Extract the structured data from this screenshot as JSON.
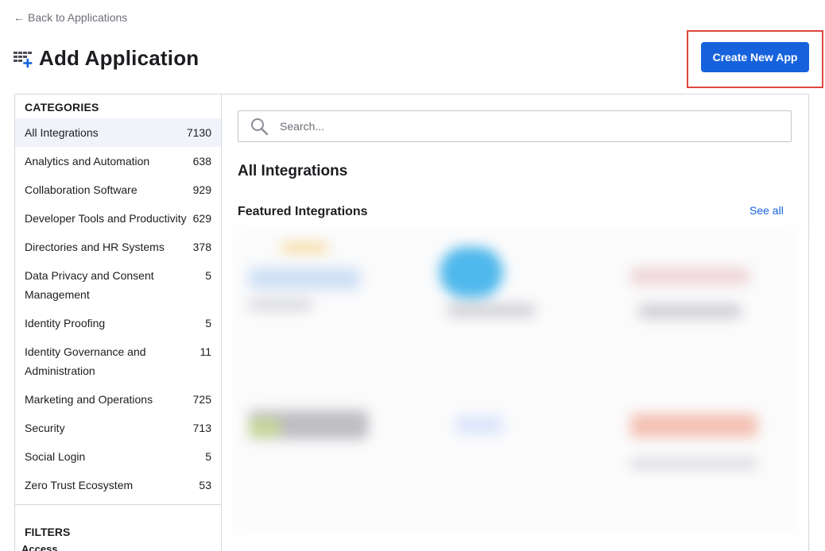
{
  "nav": {
    "back_label": "Back to Applications"
  },
  "header": {
    "title": "Add Application",
    "create_button": "Create New App"
  },
  "sidebar": {
    "categories_heading": "CATEGORIES",
    "categories": [
      {
        "label": "All Integrations",
        "count": "7130"
      },
      {
        "label": "Analytics and Automation",
        "count": "638"
      },
      {
        "label": "Collaboration Software",
        "count": "929"
      },
      {
        "label": "Developer Tools and Productivity",
        "count": "629"
      },
      {
        "label": "Directories and HR Systems",
        "count": "378"
      },
      {
        "label": "Data Privacy and Consent Management",
        "count": "5"
      },
      {
        "label": "Identity Proofing",
        "count": "5"
      },
      {
        "label": "Identity Governance and Administration",
        "count": "11"
      },
      {
        "label": "Marketing and Operations",
        "count": "725"
      },
      {
        "label": "Security",
        "count": "713"
      },
      {
        "label": "Social Login",
        "count": "5"
      },
      {
        "label": "Zero Trust Ecosystem",
        "count": "53"
      }
    ],
    "filters_heading": "FILTERS",
    "filters_sub": "Access"
  },
  "main": {
    "search_placeholder": "Search...",
    "section_title": "All Integrations",
    "featured_title": "Featured Integrations",
    "see_all": "See all"
  },
  "colors": {
    "accent": "#1662dd",
    "highlight": "#e0473f",
    "active_bg": "#f0f3fa"
  },
  "icons": {
    "back": "arrow-left-icon",
    "title": "apps-grid-plus-icon",
    "search": "search-icon"
  }
}
